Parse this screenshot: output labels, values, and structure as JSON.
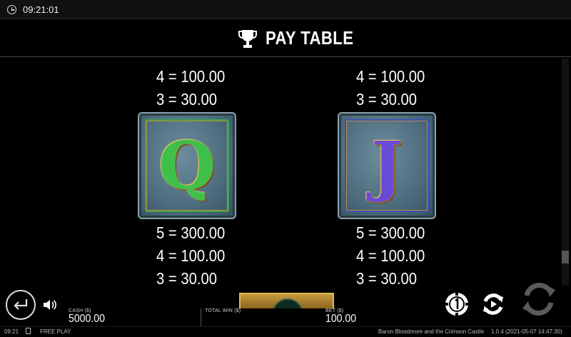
{
  "status_bar": {
    "time": "09:21:01"
  },
  "header": {
    "title": "PAY TABLE",
    "icon": "trophy-icon"
  },
  "symbols": [
    {
      "name": "Q",
      "top_lines": [
        "4 = 100.00",
        "3 = 30.00"
      ],
      "bottom_lines": [
        "5 = 300.00",
        "4 = 100.00",
        "3 = 30.00"
      ]
    },
    {
      "name": "J",
      "top_lines": [
        "4 = 100.00",
        "3 = 30.00"
      ],
      "bottom_lines": [
        "5 = 300.00",
        "4 = 100.00",
        "3 = 30.00"
      ]
    }
  ],
  "bottom_bar": {
    "cash_label": "CASH ($)",
    "cash_value": "5000.00",
    "total_win_label": "TOTAL WIN ($)",
    "bet_label": "BET ($)",
    "bet_value": "100.00"
  },
  "footer": {
    "time": "09:21",
    "mode": "FREE PLAY",
    "game_name": "Baron Bloodmore and the Crimson Castle",
    "version": "1.0.4 (2021-05-07 14:47:30)"
  },
  "colors": {
    "background": "#000000",
    "card_gold": "#c08d3a",
    "q_green": "#3fc04a",
    "j_purple": "#6b4ad8"
  }
}
